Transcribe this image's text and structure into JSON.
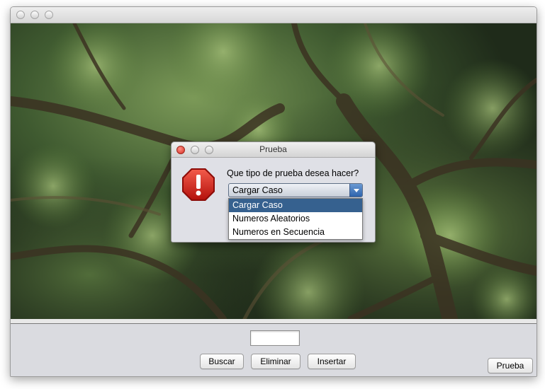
{
  "main_window": {
    "title": ""
  },
  "bottom_bar": {
    "text_value": "",
    "buttons": {
      "buscar": "Buscar",
      "eliminar": "Eliminar",
      "insertar": "Insertar",
      "prueba": "Prueba"
    }
  },
  "dialog": {
    "title": "Prueba",
    "icon": "warning-stop-icon",
    "message": "Que tipo de prueba desea hacer?",
    "combo": {
      "selected": "Cargar Caso",
      "options": [
        "Cargar Caso",
        "Numeros Aleatorios",
        "Numeros en Secuencia"
      ],
      "highlighted_index": 0
    }
  },
  "colors": {
    "selection": "#36618f",
    "warning_red": "#d61f1f",
    "panel_bg": "#dadbe0"
  }
}
